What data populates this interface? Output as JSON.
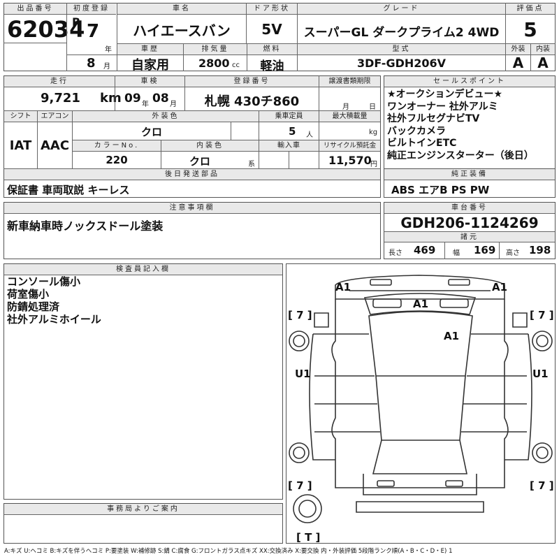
{
  "header": {
    "lot_label": "出品番号",
    "lot_number": "62034",
    "first_reg_label": "初度登録",
    "era": "R",
    "year": "7",
    "year_unit": "年",
    "month": "8",
    "month_unit": "月",
    "car_name_label": "車名",
    "car_name": "ハイエースバン",
    "door_label": "ドア形状",
    "door": "5V",
    "grade_label": "グレード",
    "grade": "スーパーGL ダークプライム2 4WD",
    "score_label": "評価点",
    "score": "5",
    "history_label": "車歴",
    "history": "自家用",
    "displacement_label": "排気量",
    "displacement": "2800",
    "displacement_unit": "cc",
    "fuel_label": "燃料",
    "fuel": "軽油",
    "model_label": "型式",
    "model": "3DF-GDH206V",
    "exterior_label": "外装",
    "exterior_grade": "A",
    "interior_label": "内装",
    "interior_grade": "A"
  },
  "details": {
    "mileage_label": "走行",
    "mileage": "9,721",
    "mileage_unit": "km",
    "inspection_label": "車検",
    "inspection_year": "09",
    "inspection_year_unit": "年",
    "inspection_month": "08",
    "inspection_month_unit": "月",
    "plate_label": "登録番号",
    "plate": "札幌 430チ860",
    "transfer_label": "譲渡書類期限",
    "transfer_month_unit": "月",
    "transfer_day_unit": "日",
    "shift_label": "シフト",
    "shift": "IAT",
    "ac_label": "エアコン",
    "ac": "AAC",
    "color_label": "外装色",
    "color": "クロ",
    "capacity_label": "乗車定員",
    "capacity": "5",
    "capacity_unit": "人",
    "load_label": "最大積載量",
    "load_unit": "kg",
    "color_no_label": "カラーNo.",
    "color_no": "220",
    "interior_color_label": "内装色",
    "interior_color": "クロ",
    "interior_color_unit": "系",
    "import_label": "輸入車",
    "recycle_label": "リサイクル預託金",
    "recycle": "11,570",
    "recycle_unit": "円",
    "deferred_label": "後日発送部品",
    "deferred": "保証書 車両取説 キーレス"
  },
  "sales_points": {
    "label": "セールスポイント",
    "items": [
      "★オークションデビュー★",
      "ワンオーナー 社外アルミ",
      "社外フルセグナビTV",
      "バックカメラ",
      "ビルトインETC",
      "純正エンジンスターター（後日）"
    ]
  },
  "equipment": {
    "label": "純正装備",
    "value": "ABS エアB PS PW"
  },
  "caution": {
    "label": "注意事項欄",
    "value": "新車納車時ノックスドール塗装"
  },
  "chassis": {
    "label": "車台番号",
    "value": "GDH206-1124269",
    "specs_label": "諸元",
    "length_label": "長さ",
    "length": "469",
    "width_label": "幅",
    "width": "169",
    "height_label": "高さ",
    "height": "198"
  },
  "inspector": {
    "label": "検査員記入欄",
    "notes": [
      "コンソール傷小",
      "荷室傷小",
      "防錆処理済",
      "社外アルミホイール"
    ]
  },
  "office": {
    "label": "事務局よりご案内"
  },
  "diagram": {
    "marks": {
      "front_left": "A1",
      "front_right": "A1",
      "windshield": "A1",
      "roof": "A1",
      "door_left": "U1",
      "door_right": "U1"
    },
    "tread": {
      "front_left": "[ 7 ]",
      "front_right": "[ 7 ]",
      "rear_left": "[ 7 ]",
      "rear_right": "[ 7 ]",
      "spare": "[ T ]"
    }
  },
  "legend": "A:キズ U:ヘコミ B:キズを伴うヘコミ P:要塗装 W:補修跡 S:錆 C:腐食 G:フロントガラス点キズ XX:交換済み X:要交換 内・外装評価 5段階ランク順(A・B・C・D・E) 1"
}
